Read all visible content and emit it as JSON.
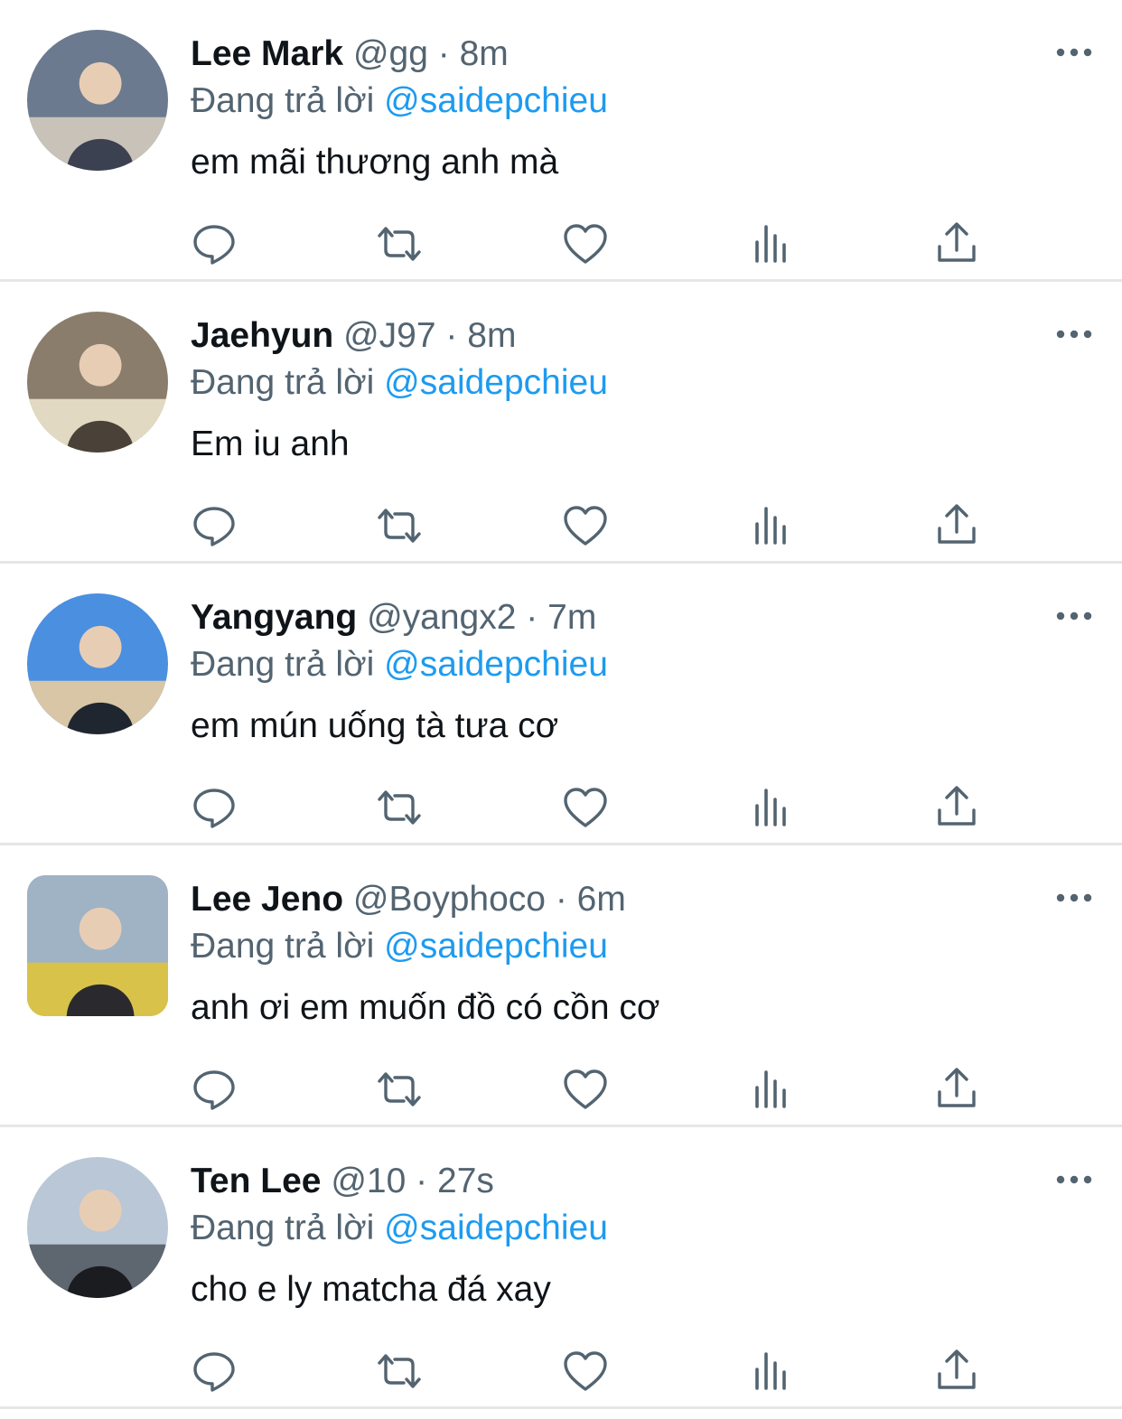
{
  "tweets": [
    {
      "name": "Lee Mark",
      "handle": "@gg",
      "separator": "·",
      "time": "8m",
      "reply_prefix": "Đang trả lời",
      "reply_to": "@saidepchieu",
      "text": "em mãi thương anh mà",
      "avatar_colors": [
        "#6b7a8f",
        "#c9c2b8",
        "#3b4150"
      ]
    },
    {
      "name": "Jaehyun",
      "handle": "@J97",
      "separator": "·",
      "time": "8m",
      "reply_prefix": "Đang trả lời",
      "reply_to": "@saidepchieu",
      "text": "Em iu anh",
      "avatar_colors": [
        "#8a7d6b",
        "#e2d9c2",
        "#4a4238"
      ]
    },
    {
      "name": "Yangyang",
      "handle": "@yangx2",
      "separator": "·",
      "time": "7m",
      "reply_prefix": "Đang trả lời",
      "reply_to": "@saidepchieu",
      "text": "em mún uống tà tưa cơ",
      "avatar_colors": [
        "#4a8fe0",
        "#d8c6a6",
        "#1f2630"
      ]
    },
    {
      "name": "Lee Jeno",
      "handle": "@Boyphoco",
      "separator": "·",
      "time": "6m",
      "reply_prefix": "Đang trả lời",
      "reply_to": "@saidepchieu",
      "text": "anh ơi em muốn đồ có cồn cơ",
      "avatar_colors": [
        "#9fb3c4",
        "#d9c24a",
        "#2a2a2e"
      ]
    },
    {
      "name": "Ten Lee",
      "handle": "@10",
      "separator": "·",
      "time": "27s",
      "reply_prefix": "Đang trả lời",
      "reply_to": "@saidepchieu",
      "text": "cho e ly matcha đá xay",
      "avatar_colors": [
        "#b9c7d6",
        "#5e6670",
        "#1a1c20"
      ]
    }
  ],
  "icons": {
    "more": "more-icon",
    "reply": "reply-icon",
    "retweet": "retweet-icon",
    "like": "heart-icon",
    "views": "views-icon",
    "share": "share-icon"
  },
  "colors": {
    "text": "#0f1419",
    "meta": "#536471",
    "mention": "#1d9bf0",
    "divider": "#e6e6e6"
  }
}
